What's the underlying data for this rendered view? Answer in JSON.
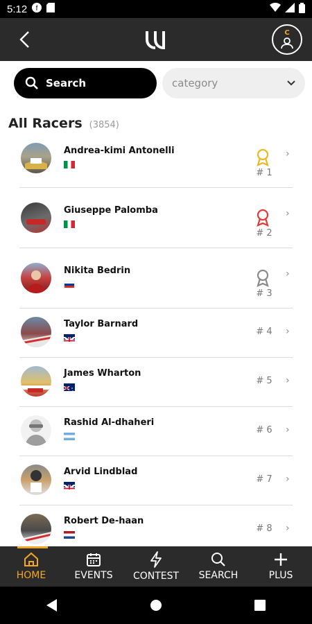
{
  "status_bar": {
    "time": "5:12"
  },
  "header": {
    "logo_icon": "udacity-style-logo",
    "profile_initial": "C"
  },
  "filters": {
    "search_label": "Search",
    "category_value": "category"
  },
  "section": {
    "title": "All Racers",
    "count": "(3854)"
  },
  "racers": [
    {
      "name": "Andrea-kimi Antonelli",
      "flag": "italy",
      "rank": "# 1",
      "medal": "gold"
    },
    {
      "name": "Giuseppe Palomba",
      "flag": "italy",
      "rank": "# 2",
      "medal": "red"
    },
    {
      "name": "Nikita Bedrin",
      "flag": "russia",
      "rank": "# 3",
      "medal": "gray"
    },
    {
      "name": "Taylor Barnard",
      "flag": "uk",
      "rank": "# 4",
      "medal": ""
    },
    {
      "name": "James Wharton",
      "flag": "australia",
      "rank": "# 5",
      "medal": ""
    },
    {
      "name": "Rashid Al-dhaheri",
      "flag": "argentina",
      "rank": "# 6",
      "medal": ""
    },
    {
      "name": "Arvid Lindblad",
      "flag": "uk",
      "rank": "# 7",
      "medal": ""
    },
    {
      "name": "Robert De-haan",
      "flag": "netherlands",
      "rank": "# 8",
      "medal": ""
    }
  ],
  "bottom_nav": [
    {
      "label": "HOME",
      "icon": "home-icon",
      "active": true
    },
    {
      "label": "EVENTS",
      "icon": "calendar-icon",
      "active": false
    },
    {
      "label": "CONTEST",
      "icon": "lightning-icon",
      "active": false
    },
    {
      "label": "SEARCH",
      "icon": "search-icon",
      "active": false
    },
    {
      "label": "PLUS",
      "icon": "plus-icon",
      "active": false
    }
  ],
  "colors": {
    "accent": "#f5a623",
    "gold": "#e8b923",
    "red": "#e53935",
    "gray": "#8a8a8a",
    "bar": "#2b2b2b"
  }
}
